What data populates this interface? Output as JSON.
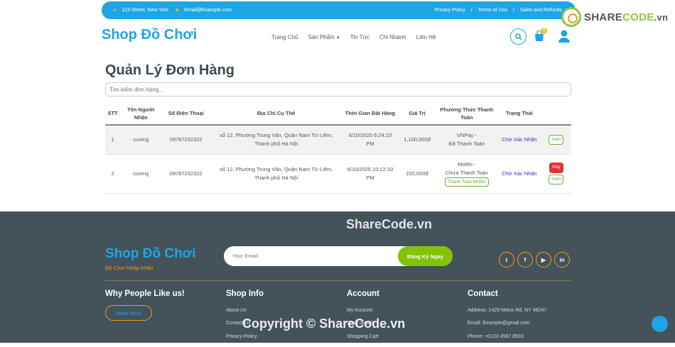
{
  "topbar": {
    "address": "123 Street, New York",
    "email": "Email@Example.com",
    "links": [
      "Privacy Policy",
      "/",
      "Terms of Use",
      "/",
      "Sales and Refunds"
    ]
  },
  "watermark_logo": {
    "share": "SHARE",
    "code": "CODE",
    "vn": ".vn"
  },
  "header": {
    "shop_title": "Shop Đồ Chơi",
    "nav": [
      "Trang Chủ",
      "Sản Phẩm",
      "Tin Tức",
      "Chi Nhánh",
      "Liên Hệ"
    ],
    "cart_count": "0"
  },
  "main": {
    "title": "Quản Lý Đơn Hàng",
    "search_placeholder": "Tìm kiếm đơn hàng...",
    "columns": [
      "STT",
      "Tên Người Nhận",
      "Số Điện Thoại",
      "Địa Chỉ Cụ Thể",
      "Thời Gian Đặt Hàng",
      "Giá Trị",
      "Phương Thức Thanh Toán",
      "Trạng Thái",
      ""
    ],
    "rows": [
      {
        "stt": "1",
        "name": "cương",
        "phone": "09787232322",
        "address": "số 12, Phường Trung Văn, Quận Nam Từ Liêm, Thành phố Hà Nội",
        "time": "6/10/2025 6:24:23 PM",
        "value": "1,100,000đ",
        "payment_method": "VNPay -",
        "payment_status": "Đã Thanh Toán",
        "status": "Chờ Xác Nhận",
        "view": "Xem"
      },
      {
        "stt": "2",
        "name": "cương",
        "phone": "09787232322",
        "address": "số 12, Phường Trung Văn, Quận Nam Từ Liêm, Thành phố Hà Nội",
        "time": "6/10/2025 10:12:33 PM",
        "value": "220,000đ",
        "payment_method": "MoMo -",
        "payment_status": "Chưa Thanh Toán",
        "pay_button": "Thanh Toán MoMo",
        "status": "Chờ Xác Nhận",
        "cancel": "Hủy",
        "view": "Xem"
      }
    ]
  },
  "footer": {
    "watermark": "ShareCode.vn",
    "brand": "Shop Đồ Chơi",
    "sub": "Đồ Chơi Nhập Khẩu",
    "email_placeholder": "Your Email",
    "subscribe": "Đăng Ký Ngay",
    "socials": [
      "t",
      "f",
      "▶",
      "in"
    ],
    "col1": {
      "title": "Why People Like us!",
      "button": "Read More"
    },
    "col2": {
      "title": "Shop Info",
      "items": [
        "About Us",
        "Contact Us",
        "Privacy Policy"
      ]
    },
    "col3": {
      "title": "Account",
      "items": [
        "My Account",
        "Shop details",
        "Shopping Cart"
      ]
    },
    "col4": {
      "title": "Contact",
      "items": [
        "Address: 1429 Netus Rd, NY 48247",
        "Email: Example@gmail.com",
        "Phone: +0123 4567 8910"
      ]
    },
    "copyright": "Copyright © ShareCode.vn"
  },
  "colors": {
    "primary": "#1ea5e6",
    "secondary": "#f39c12",
    "green": "#81c408",
    "footer_bg": "#44525a"
  }
}
